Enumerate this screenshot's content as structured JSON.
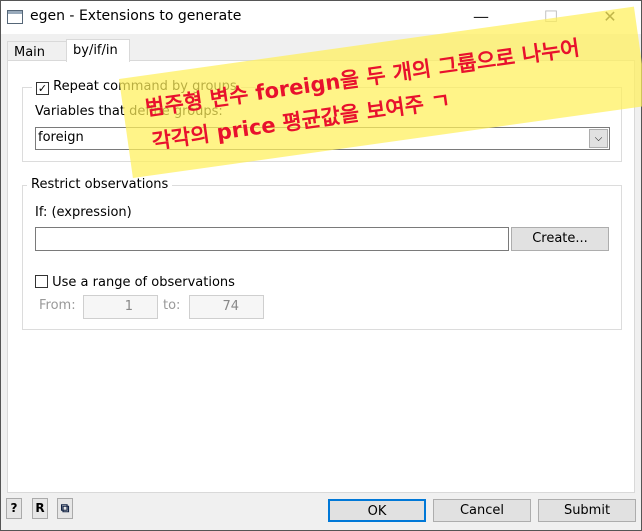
{
  "window": {
    "title": "egen - Extensions to generate",
    "minimize": "—",
    "maximize": "☐",
    "close": "✕"
  },
  "tabs": [
    {
      "label": "Main"
    },
    {
      "label": "by/if/in"
    }
  ],
  "by_group": {
    "checkbox_label": "Repeat command by groups",
    "checked": true,
    "vars_label": "Variables that define groups:",
    "vars_value": "foreign"
  },
  "restrict": {
    "title": "Restrict observations",
    "if_label": "If: (expression)",
    "if_value": "",
    "create_label": "Create...",
    "range_label": "Use a range of observations",
    "range_checked": false,
    "from_label": "From:",
    "from_value": "1",
    "to_label": "to:",
    "to_value": "74"
  },
  "annotation": {
    "line1": "범주형 변수 foreign을  두 개의 그룹으로 나누어",
    "line2": "각각의 price 평균값을 보여주 ㄱ"
  },
  "footer": {
    "help": "?",
    "reset": "R",
    "copy": "⧉",
    "ok": "OK",
    "cancel": "Cancel",
    "submit": "Submit"
  }
}
